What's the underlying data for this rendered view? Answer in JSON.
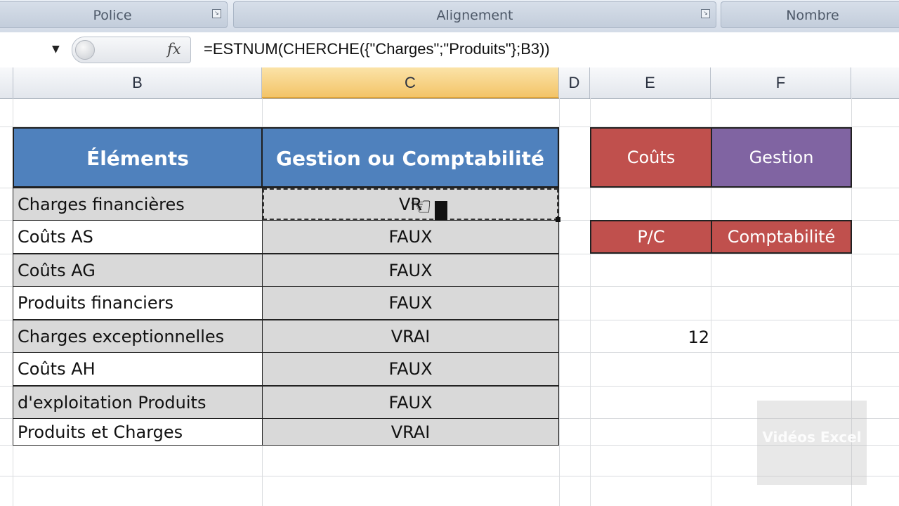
{
  "ribbon": {
    "groups": [
      {
        "label": "Police"
      },
      {
        "label": "Alignement"
      },
      {
        "label": "Nombre"
      }
    ]
  },
  "formula_bar": {
    "fx_label": "fx",
    "formula": "=ESTNUM(CHERCHE({\"Charges\";\"Produits\"};B3))"
  },
  "columns": [
    "B",
    "C",
    "D",
    "E",
    "F"
  ],
  "table": {
    "headers": [
      "Éléments",
      "Gestion ou Comptabilité"
    ],
    "rows": [
      {
        "element": "Charges financières",
        "value": "VRAI",
        "shown": "VR"
      },
      {
        "element": "Coûts AS",
        "value": "FAUX"
      },
      {
        "element": "Coûts AG",
        "value": "FAUX"
      },
      {
        "element": "Produits financiers",
        "value": "FAUX"
      },
      {
        "element": "Charges exceptionnelles",
        "value": "VRAI"
      },
      {
        "element": "Coûts AH",
        "value": "FAUX"
      },
      {
        "element": "d'exploitation Produits",
        "value": "FAUX"
      },
      {
        "element": "Produits et Charges",
        "value": "VRAI"
      }
    ]
  },
  "legend": {
    "row1": {
      "left": "Coûts",
      "right": "Gestion"
    },
    "row2": {
      "left": "P/C",
      "right": "Comptabilité"
    }
  },
  "loose_value": "12",
  "watermark": "Vidéos Excel",
  "colors": {
    "header_blue": "#4f81bd",
    "red": "#c0504d",
    "purple": "#8064a2",
    "cell_grey": "#d9d9d9",
    "active_col": "#f3c468"
  }
}
